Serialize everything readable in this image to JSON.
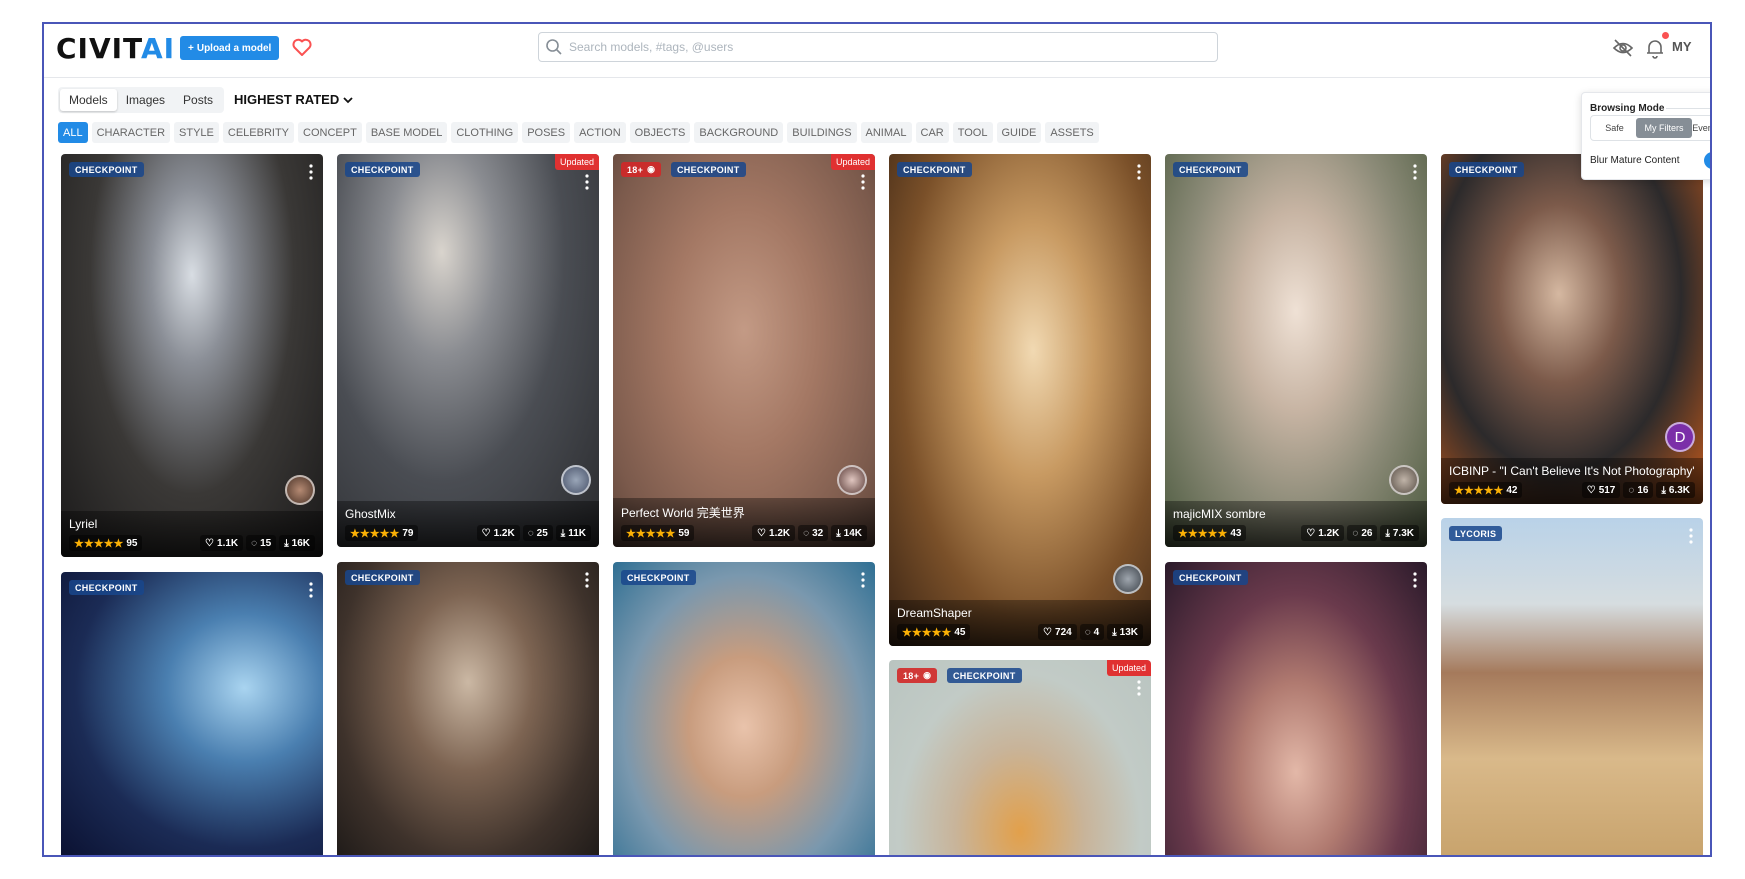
{
  "header": {
    "logo_main": "CIVIT",
    "logo_accent": "AI",
    "upload_label": "Upload a model",
    "search_placeholder": "Search models, #tags, @users",
    "user_initials": "MY"
  },
  "tabs": [
    "Models",
    "Images",
    "Posts"
  ],
  "active_tab": "Models",
  "sort_label": "HIGHEST RATED",
  "categories": [
    "ALL",
    "CHARACTER",
    "STYLE",
    "CELEBRITY",
    "CONCEPT",
    "BASE MODEL",
    "CLOTHING",
    "POSES",
    "ACTION",
    "OBJECTS",
    "BACKGROUND",
    "BUILDINGS",
    "ANIMAL",
    "CAR",
    "TOOL",
    "GUIDE",
    "ASSETS"
  ],
  "browsing_mode": {
    "title": "Browsing Mode",
    "options": [
      "Safe",
      "My Filters",
      "Everything"
    ],
    "selected": "My Filters",
    "blur_label": "Blur Mature Content",
    "blur_enabled": true
  },
  "cards": [
    {
      "type": "CHECKPOINT",
      "name": "Lyriel",
      "rating": 95,
      "likes": "1.1K",
      "comments": "15",
      "downloads": "16K",
      "updated": "",
      "nsfw": false,
      "avatar_initial": ""
    },
    {
      "type": "CHECKPOINT",
      "name": "GhostMix",
      "rating": 79,
      "likes": "1.2K",
      "comments": "25",
      "downloads": "11K",
      "updated": "Updated",
      "nsfw": false,
      "avatar_initial": ""
    },
    {
      "type": "CHECKPOINT",
      "name": "Perfect World 完美世界",
      "rating": 59,
      "likes": "1.2K",
      "comments": "32",
      "downloads": "14K",
      "updated": "Updated",
      "nsfw": true,
      "nsfw_label": "18+",
      "avatar_initial": ""
    },
    {
      "type": "CHECKPOINT",
      "name": "DreamShaper",
      "rating": 45,
      "likes": "724",
      "comments": "4",
      "downloads": "13K",
      "updated": "",
      "nsfw": false,
      "avatar_initial": ""
    },
    {
      "type": "CHECKPOINT",
      "name": "majicMIX sombre",
      "rating": 43,
      "likes": "1.2K",
      "comments": "26",
      "downloads": "7.3K",
      "updated": "",
      "nsfw": false,
      "avatar_initial": ""
    },
    {
      "type": "CHECKPOINT",
      "name": "ICBINP - \"I Can't Believe It's Not Photography\"",
      "rating": 42,
      "likes": "517",
      "comments": "16",
      "downloads": "6.3K",
      "updated": "",
      "nsfw": false,
      "avatar_initial": "D"
    },
    {
      "type": "CHECKPOINT",
      "name": "",
      "updated": "",
      "nsfw": false
    },
    {
      "type": "CHECKPOINT",
      "name": "",
      "updated": "",
      "nsfw": false
    },
    {
      "type": "CHECKPOINT",
      "name": "",
      "updated": "",
      "nsfw": false
    },
    {
      "type": "CHECKPOINT",
      "name": "",
      "updated": "Updated",
      "nsfw": true,
      "nsfw_label": "18+"
    },
    {
      "type": "CHECKPOINT",
      "name": "",
      "updated": "",
      "nsfw": false
    },
    {
      "type": "LYCORIS",
      "name": "",
      "updated": "",
      "nsfw": false
    }
  ],
  "colors": {
    "accent": "#228be6",
    "updated": "#e03131",
    "nsfw": "#d22828",
    "star": "#fab005"
  }
}
